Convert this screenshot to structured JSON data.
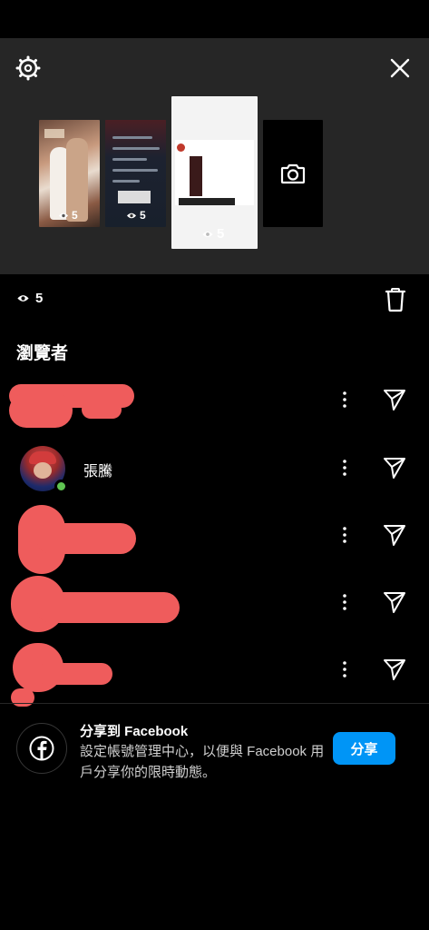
{
  "story_tray": {
    "thumbnails": [
      {
        "views": "5"
      },
      {
        "views": "5"
      },
      {
        "views": "5",
        "selected": true
      },
      {
        "icon": "camera-icon"
      }
    ]
  },
  "stats": {
    "view_count": "5"
  },
  "viewers": {
    "heading": "瀏覽者",
    "list": [
      {
        "name": "",
        "redacted": true
      },
      {
        "name": "張騰",
        "redacted": false,
        "online": true
      },
      {
        "name": "",
        "redacted": true
      },
      {
        "name": "",
        "redacted": true
      },
      {
        "name": "",
        "redacted": true
      }
    ]
  },
  "facebook_share": {
    "title": "分享到 Facebook",
    "description": "設定帳號管理中心，以便與 Facebook 用戶分享你的限時動態。",
    "button_label": "分享"
  },
  "colors": {
    "panel": "#262626",
    "accent": "#0095f6",
    "online": "#5fc552",
    "redaction": "#ef5c5c"
  }
}
